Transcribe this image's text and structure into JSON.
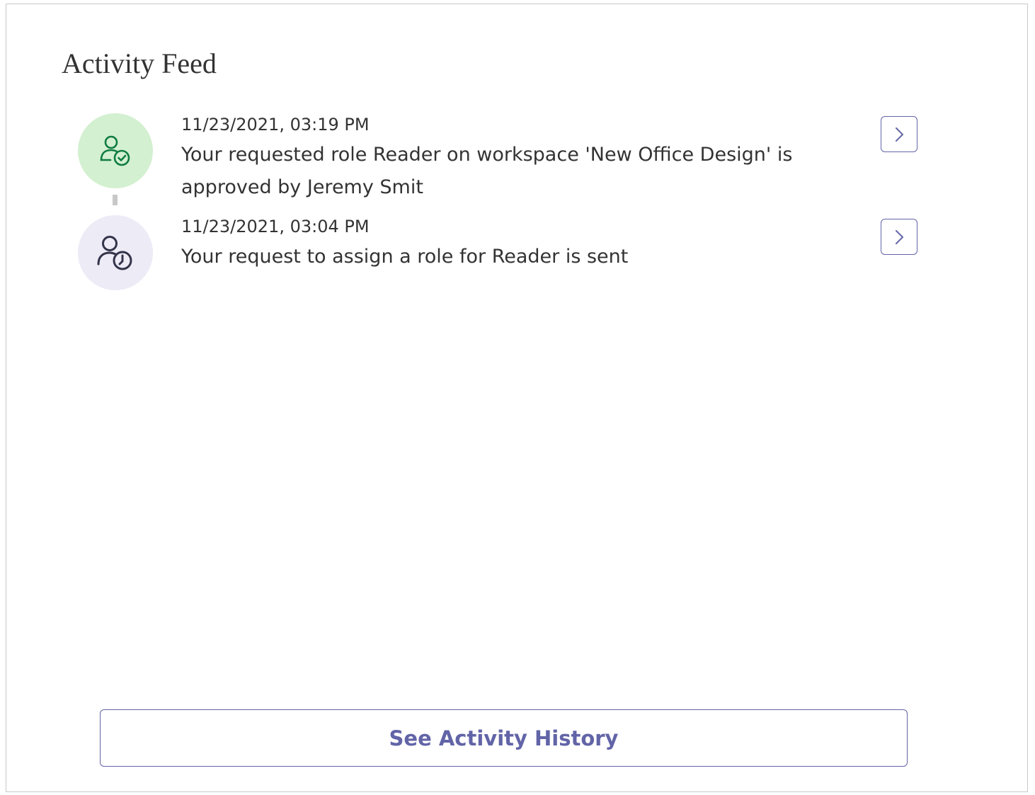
{
  "panel": {
    "title": "Activity Feed"
  },
  "feed": {
    "items": [
      {
        "timestamp": "11/23/2021, 03:19 PM",
        "message": "Your requested role Reader on workspace 'New Office Design' is approved by Jeremy Smit",
        "icon": "person-approved-icon",
        "icon_color": "#107c41",
        "icon_bg": "#d3f0d0"
      },
      {
        "timestamp": "11/23/2021, 03:04 PM",
        "message": "Your request to assign a role for Reader is sent",
        "icon": "person-pending-icon",
        "icon_color": "#33344a",
        "icon_bg": "#ecebf6"
      }
    ]
  },
  "footer": {
    "history_button_label": "See Activity History"
  },
  "colors": {
    "accent": "#6264a7",
    "text": "#333333",
    "border": "#c8c8c8"
  }
}
